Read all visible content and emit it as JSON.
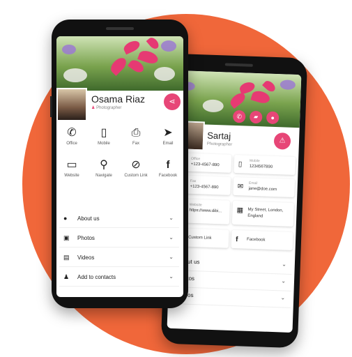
{
  "colors": {
    "accent": "#e74677",
    "background_blob": "#f0673a"
  },
  "front": {
    "profile": {
      "name": "Osama Riaz",
      "title": "Photographer"
    },
    "contact_grid": [
      {
        "label": "Office",
        "icon": "phone-icon"
      },
      {
        "label": "Mobile",
        "icon": "mobile-icon"
      },
      {
        "label": "Fax",
        "icon": "fax-icon"
      },
      {
        "label": "Email",
        "icon": "send-icon"
      },
      {
        "label": "Website",
        "icon": "laptop-icon"
      },
      {
        "label": "Navigate",
        "icon": "map-person-icon"
      },
      {
        "label": "Custom Link",
        "icon": "compass-icon"
      },
      {
        "label": "Facebook",
        "icon": "facebook-icon"
      }
    ],
    "accordion": [
      {
        "label": "About us",
        "icon": "info-icon"
      },
      {
        "label": "Photos",
        "icon": "image-icon"
      },
      {
        "label": "Videos",
        "icon": "video-icon"
      },
      {
        "label": "Add to contacts",
        "icon": "add-person-icon"
      }
    ]
  },
  "back": {
    "profile": {
      "name": "Sartaj",
      "title": "Photographer"
    },
    "cards": [
      {
        "label": "Office",
        "value": "+123-4567-890",
        "icon": "phone-icon"
      },
      {
        "label": "Mobile",
        "value": "1234567890",
        "icon": "mobile-icon"
      },
      {
        "label": "Fax",
        "value": "+123-4567-890",
        "icon": "fax-icon"
      },
      {
        "label": "Email",
        "value": "jane@doe.com",
        "icon": "mail-icon"
      },
      {
        "label": "Website",
        "value": "https://www.dibi...",
        "icon": "globe-icon"
      },
      {
        "label": "",
        "value": "My Street, London, England",
        "icon": "map-icon"
      },
      {
        "label": "",
        "value": "Custom Link",
        "icon": "link-icon"
      },
      {
        "label": "",
        "value": "Facebook",
        "icon": "facebook-icon"
      }
    ],
    "accordion": [
      {
        "label": "About us"
      },
      {
        "label": "Photos"
      },
      {
        "label": "Videos"
      }
    ]
  }
}
